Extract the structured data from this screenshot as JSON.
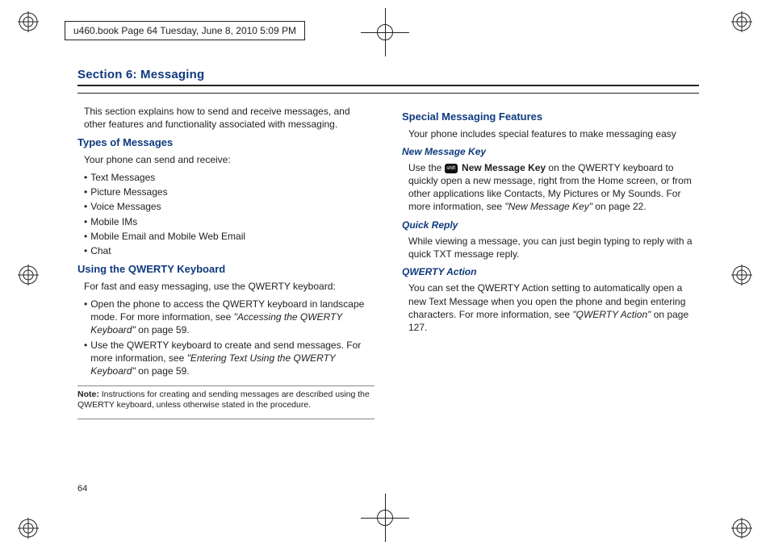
{
  "meta": {
    "header_line": "u460.book  Page 64  Tuesday, June 8, 2010  5:09 PM",
    "page_number": "64"
  },
  "section_title": "Section 6:  Messaging",
  "left": {
    "intro": "This section explains how to send and receive messages, and other features and functionality associated with messaging.",
    "h_types": "Types of Messages",
    "types_intro": "Your phone can send and receive:",
    "types": [
      "Text Messages",
      "Picture Messages",
      "Voice Messages",
      "Mobile IMs",
      "Mobile Email and Mobile Web Email",
      "Chat"
    ],
    "h_qwerty": "Using the QWERTY Keyboard",
    "qwerty_intro": "For fast and easy messaging, use the QWERTY keyboard:",
    "qwerty_b1_a": "Open the phone to access the QWERTY keyboard in landscape mode. For more information, see ",
    "qwerty_b1_ref": "\"Accessing the QWERTY Keyboard\"",
    "qwerty_b1_b": " on page 59.",
    "qwerty_b2_a": "Use the QWERTY keyboard to create and send messages. For more information, see ",
    "qwerty_b2_ref": "\"Entering Text Using the QWERTY Keyboard\"",
    "qwerty_b2_b": " on page 59.",
    "note_label": "Note: ",
    "note_text": "Instructions for creating and sending messages are described using the QWERTY keyboard, unless otherwise stated in the procedure."
  },
  "right": {
    "h_special": "Special Messaging Features",
    "special_intro": "Your phone includes special features to make messaging easy",
    "h_newkey": "New Message Key",
    "newkey_a": "Use the ",
    "newkey_glyph": "shift",
    "newkey_strong": " New Message Key",
    "newkey_b": " on the QWERTY keyboard to quickly open a new message, right from the Home screen, or from other applications like Contacts, My Pictures or My Sounds. For more information, see ",
    "newkey_ref": "\"New Message Key\"",
    "newkey_c": " on page 22.",
    "h_quick": "Quick Reply",
    "quick_text": "While viewing a message, you can just begin typing to reply with a quick TXT message reply.",
    "h_action": "QWERTY Action",
    "action_a": "You can set the QWERTY Action setting to automatically open a new Text Message when you open the phone and begin entering characters. For more information, see ",
    "action_ref": "\"QWERTY Action\"",
    "action_b": " on page 127."
  }
}
